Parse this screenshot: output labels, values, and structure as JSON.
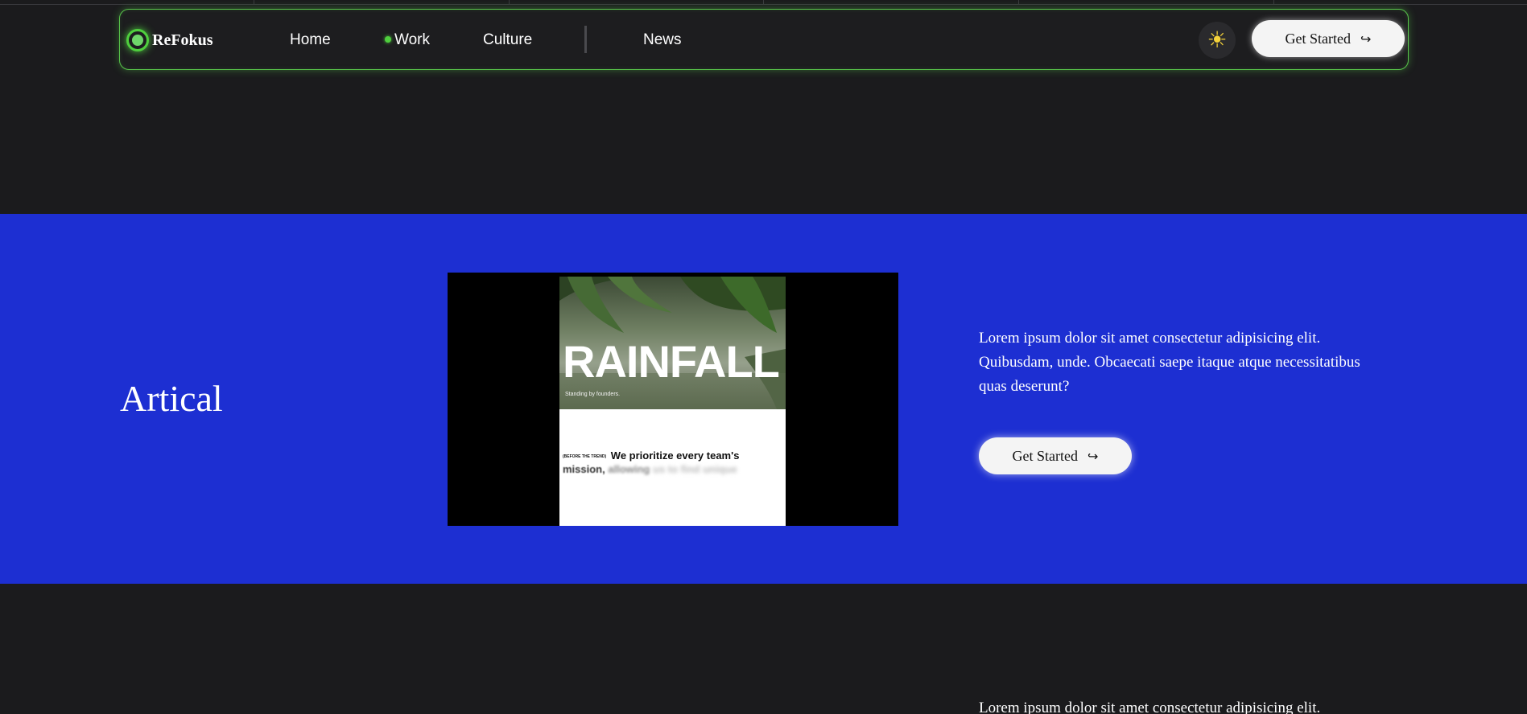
{
  "nav": {
    "logo": "ReFokus",
    "links": [
      "Home",
      "Work",
      "Culture",
      "News"
    ],
    "active_link": "Work",
    "theme_icon": "sun-icon",
    "cta_label": "Get Started",
    "cta_icon": "arrow-return-right-icon"
  },
  "featured": {
    "title": "Artical",
    "poster": {
      "title": "RAINFALL",
      "subtitle": "Standing by founders.",
      "kicker": "(BEFORE THE TREND)",
      "headline_sharp": "We prioritize every team's",
      "headline_fade_1": "mission,",
      "headline_fade_2": "allowing",
      "headline_fade_3": "us to find unique"
    },
    "description": "Lorem ipsum dolor sit amet consectetur adipisicing elit. Quibusdam, unde. Obcaecati saepe itaque atque necessitatibus quas deserunt?",
    "cta_label": "Get Started"
  },
  "next_section": {
    "description": "Lorem ipsum dolor sit amet consectetur adipisicing elit."
  },
  "colors": {
    "background": "#1b1b1d",
    "accent_green": "#4fcf3e",
    "section_blue": "#1d2fd2",
    "button_bg": "#f4f4f4",
    "sun_yellow": "#f4d23a"
  }
}
